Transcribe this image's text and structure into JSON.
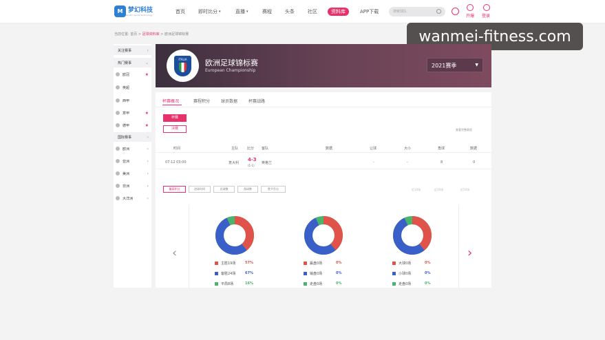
{
  "nav": {
    "logo_text": "梦幻科技",
    "logo_sub": "Dream Sports Technology",
    "items": [
      "首页",
      "即时比分",
      "直播",
      "赛程",
      "头条",
      "社区",
      "资料库",
      "APP下载"
    ],
    "active_index": 6,
    "search_placeholder": "搜索球队",
    "kaibao": "开爆",
    "login": "登录"
  },
  "watermark": "wanmei-fitness.com",
  "breadcrumb": {
    "prefix": "当前位置:",
    "home": "首页",
    "db": "足球资料库",
    "current": "欧洲足球锦标赛"
  },
  "sidebar": {
    "follow": "关注赛事",
    "hot": "热门赛事",
    "hot_items": [
      "欧冠",
      "英超",
      "西甲",
      "意甲",
      "德甲"
    ],
    "intl": "国际赛事",
    "intl_items": [
      "欧洲",
      "亚洲",
      "美洲",
      "非洲",
      "大洋洲"
    ]
  },
  "banner": {
    "badge_text": "ITALIA",
    "title": "欧洲足球锦标赛",
    "subtitle": "European Championship",
    "season": "2021赛季"
  },
  "tabs": [
    "杯赛概况",
    "赛程积分",
    "球员数据",
    "杯赛战路"
  ],
  "pills": [
    "杯赛",
    "决赛"
  ],
  "right_note": "查看完整赛程",
  "table": {
    "headers": [
      "时间",
      "主队",
      "比分",
      "客队",
      "数据",
      "让球",
      "大小",
      "角球",
      "数据"
    ],
    "row": {
      "time": "07-12 03:00",
      "home": "意大利",
      "score": "4-3",
      "half": "(1-1)",
      "away": "英格兰",
      "handicap": "-",
      "ou": "-",
      "corners": "8",
      "data": "0"
    }
  },
  "filters": [
    "最高积分",
    "进球时间",
    "总球数",
    "角球数",
    "胜平负分"
  ],
  "filter_right": [
    "近10场",
    "近30场",
    "近50场"
  ],
  "charts": [
    {
      "slices": [
        {
          "label": "主胜19场",
          "pct": "57%",
          "color": "#e0534a"
        },
        {
          "label": "客胜24场",
          "pct": "67%",
          "color": "#3b5fc8"
        },
        {
          "label": "平局8场",
          "pct": "16%",
          "color": "#4ab56a"
        }
      ]
    },
    {
      "slices": [
        {
          "label": "赢盘0场",
          "pct": "0%",
          "color": "#e0534a"
        },
        {
          "label": "输盘0场",
          "pct": "0%",
          "color": "#3b5fc8"
        },
        {
          "label": "走盘0场",
          "pct": "0%",
          "color": "#4ab56a"
        }
      ]
    },
    {
      "slices": [
        {
          "label": "大球0场",
          "pct": "0%",
          "color": "#e0534a"
        },
        {
          "label": "小球0场",
          "pct": "0%",
          "color": "#3b5fc8"
        },
        {
          "label": "走盘0场",
          "pct": "0%",
          "color": "#4ab56a"
        }
      ]
    }
  ],
  "colors": {
    "accent": "#e8306b",
    "red": "#e0534a",
    "blue": "#3b5fc8",
    "green": "#4ab56a"
  }
}
